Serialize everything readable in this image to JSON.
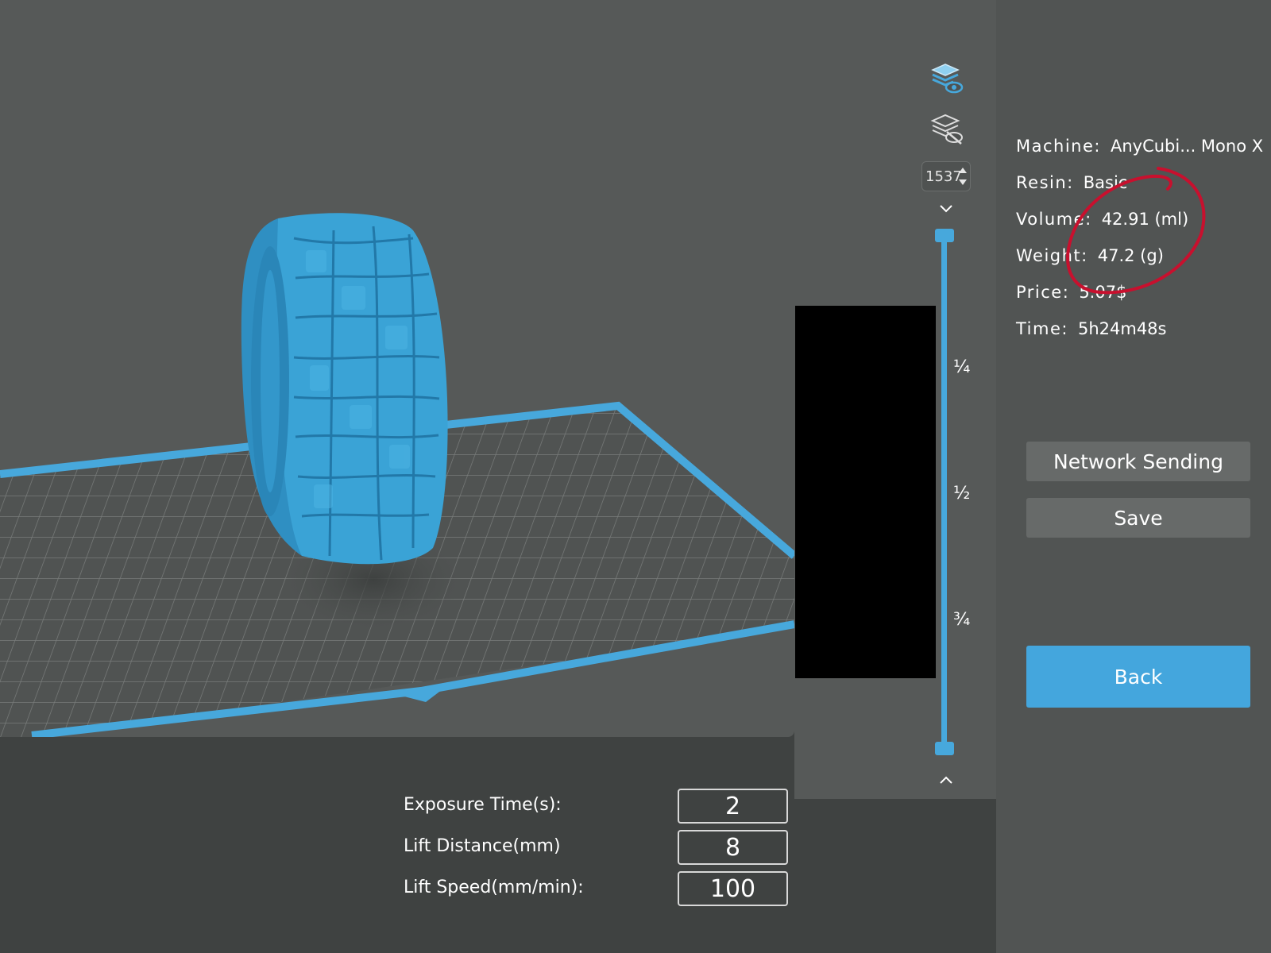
{
  "viewer": {
    "model_color": "#3aa3d6",
    "platform_color": "#47a8dc",
    "layer_count": "1537"
  },
  "slider": {
    "ticks": [
      "¼",
      "½",
      "¾"
    ],
    "accent": "#47a8dc"
  },
  "toolbar": {
    "show_layers_icon": "layers-eye-icon",
    "hide_layers_icon": "layers-eye-off-icon"
  },
  "info": {
    "machine": {
      "label": "Machine:",
      "value": "AnyCubi... Mono X"
    },
    "resin": {
      "label": "Resin:",
      "value": "Basic"
    },
    "volume": {
      "label": "Volume:",
      "value": "42.91  (ml)"
    },
    "weight": {
      "label": "Weight:",
      "value": "47.2  (g)"
    },
    "price": {
      "label": "Price:",
      "value": "5.07$"
    },
    "time": {
      "label": "Time:",
      "value": "5h24m48s"
    }
  },
  "buttons": {
    "network_sending": "Network Sending",
    "save": "Save",
    "back": "Back"
  },
  "params": {
    "exposure": {
      "label": "Exposure Time(s):",
      "value": "2"
    },
    "lift_distance": {
      "label": "Lift Distance(mm)",
      "value": "8"
    },
    "lift_speed": {
      "label": "Lift Speed(mm/min):",
      "value": "100"
    }
  },
  "annotation_color": "#c8102e"
}
